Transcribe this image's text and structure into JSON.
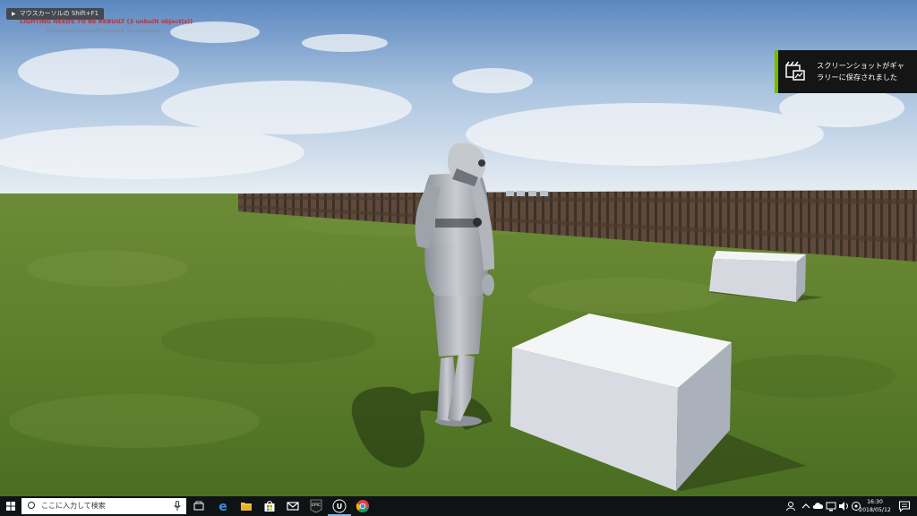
{
  "viewport": {
    "mouse_hint": "マウスカーソルの Shift+F1",
    "lighting_warning": "LIGHTING NEEDS TO BE REBUILT (3 unbuilt object(s))",
    "suppress_hint": "'DisableAllScreenMessages' to suppress"
  },
  "notification": {
    "line1": "スクリーンショットがギャ",
    "line2": "ラリーに保存されました",
    "accent_color": "#76b900",
    "icon": "screenshot-gallery-icon"
  },
  "taskbar": {
    "search_placeholder": "ここに入力して検索",
    "apps": [
      "task-view-icon",
      "edge-icon",
      "file-explorer-icon",
      "store-icon",
      "mail-icon",
      "epic-games-launcher-icon",
      "unreal-engine-icon",
      "chrome-icon"
    ],
    "active_app": "unreal-engine-icon",
    "tray_icons": [
      "person-icon",
      "chevron-up-icon",
      "cloud-icon",
      "network-icon",
      "volume-icon",
      "ime-icon"
    ],
    "epic_label": "EPIC",
    "clock_time": "16:30",
    "clock_date": "2018/05/12"
  }
}
